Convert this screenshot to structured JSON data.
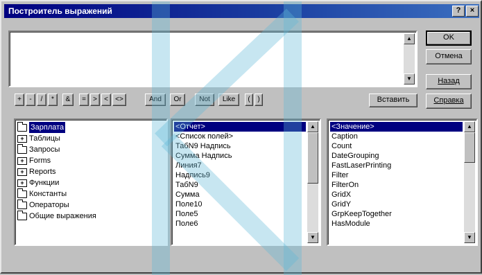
{
  "window": {
    "title": "Построитель выражений",
    "help_glyph": "?",
    "close_glyph": "×"
  },
  "buttons": {
    "ok": "OK",
    "cancel": "Отмена",
    "undo": "Назад",
    "help": "Справка",
    "paste": "Вставить"
  },
  "operators": [
    "+",
    "-",
    "/",
    "*",
    "&",
    "=",
    ">",
    "<",
    "<>",
    "And",
    "Or",
    "Not",
    "Like",
    "(",
    ")"
  ],
  "tree": {
    "items": [
      {
        "label": "Зарплата",
        "icon": "open-folder-icon",
        "selected": true
      },
      {
        "label": "Таблицы",
        "icon": "expand-plus-icon"
      },
      {
        "label": "Запросы",
        "icon": "folder-icon"
      },
      {
        "label": "Forms",
        "icon": "expand-plus-icon"
      },
      {
        "label": "Reports",
        "icon": "expand-plus-icon"
      },
      {
        "label": "Функции",
        "icon": "expand-plus-icon"
      },
      {
        "label": "Константы",
        "icon": "folder-icon"
      },
      {
        "label": "Операторы",
        "icon": "folder-icon"
      },
      {
        "label": "Общие выражения",
        "icon": "folder-icon"
      }
    ]
  },
  "middle_list": {
    "items": [
      "<Отчет>",
      "<Список полей>",
      "ТабN9 Надпись",
      "Сумма Надпись",
      "Линия7",
      "Надпись9",
      "ТабN9",
      "Сумма",
      "Поле10",
      "Поле5",
      "Поле6"
    ]
  },
  "right_list": {
    "items": [
      "<Значение>",
      "Caption",
      "Count",
      "DateGrouping",
      "FastLaserPrinting",
      "Filter",
      "FilterOn",
      "GridX",
      "GridY",
      "GrpKeepTogether",
      "HasModule"
    ]
  },
  "colors": {
    "title_start": "#000080",
    "title_end": "#3b6fc0",
    "selection": "#000080",
    "face": "#c0c0c0"
  }
}
